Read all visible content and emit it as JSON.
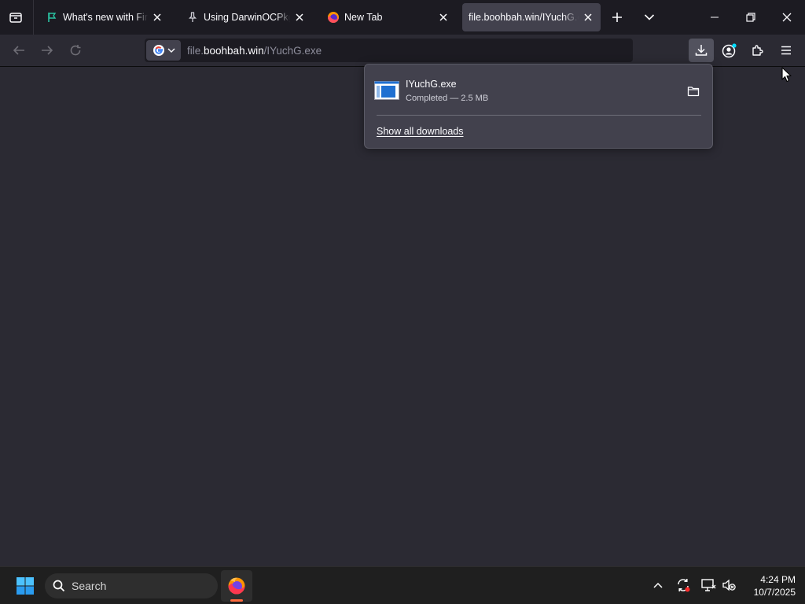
{
  "tabs": [
    {
      "title": "What's new with Firefox",
      "icon": "flag-icon"
    },
    {
      "title": "Using DarwinOCPkg | Do",
      "icon": "pin-icon"
    },
    {
      "title": "New Tab",
      "icon": "firefox-icon"
    },
    {
      "title": "file.boohbah.win/IYuchG.exe",
      "icon": "none",
      "active": true
    }
  ],
  "url": {
    "prefix": "file.",
    "host": "boohbah.win",
    "path": "/IYuchG.exe"
  },
  "downloads": {
    "items": [
      {
        "name": "IYuchG.exe",
        "status": "Completed — 2.5 MB",
        "icon": "exe-file-icon"
      }
    ],
    "show_all_label": "Show all downloads"
  },
  "taskbar": {
    "search_label": "Search",
    "time": "4:24 PM",
    "date": "10/7/2025"
  },
  "colors": {
    "chrome_dark": "#1c1b22",
    "toolbar": "#2b2a33",
    "active_tab": "#42414d",
    "panel": "#42414d",
    "accent_blue": "#00ddff",
    "firefox_orange": "#ff6a3d"
  }
}
